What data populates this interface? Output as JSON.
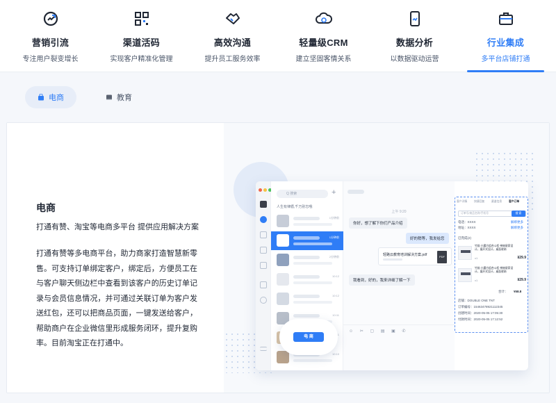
{
  "nav": {
    "items": [
      {
        "title": "营销引流",
        "sub": "专注用户裂变增长",
        "icon": "growth-icon"
      },
      {
        "title": "渠道活码",
        "sub": "实现客户精准化管理",
        "icon": "qrcode-icon"
      },
      {
        "title": "高效沟通",
        "sub": "提升员工服务效率",
        "icon": "handshake-icon"
      },
      {
        "title": "轻量级CRM",
        "sub": "建立坚固客情关系",
        "icon": "crm-cloud-icon"
      },
      {
        "title": "数据分析",
        "sub": "以数据驱动运营",
        "icon": "phone-chart-icon"
      },
      {
        "title": "行业集成",
        "sub": "多平台店铺打通",
        "icon": "briefcase-icon"
      }
    ],
    "active_index": 5,
    "accent": "#2f7df6"
  },
  "subtabs": {
    "ecommerce": "电商",
    "education": "教育"
  },
  "content": {
    "title": "电商",
    "tagline": "打通有赞、淘宝等电商多平台 提供应用解决方案",
    "description": "打通有赞等多电商平台，助力商家打造智慧新零售。可支持订单绑定客户，绑定后，方便员工在与客户聊天侧边栏中查看到该客户的历史订单记录与会员信息情况，并可通过关联订单为客户发送红包，还可以把商品页面，一键发送给客户，帮助商户在企业微信里形成服务闭环，提升复购率。目前淘宝正在打通中。"
  },
  "mock": {
    "search_placeholder": "Q 搜索",
    "notice": "人生有律循,千万别忘哦",
    "times": [
      "1分钟前",
      "1分钟前",
      "2分钟前",
      "10:12",
      "10:12",
      "10:11",
      "10:11",
      "10:10"
    ],
    "chat_time": "上午 9:20",
    "messages": {
      "m1": "你好，想了解下你们产品介绍",
      "m2": "好的稍等，我发给您",
      "file_name": "轻路云教育培训解决方案.pdf",
      "pdf": "PDF",
      "m3": "我看到，好的，我来详细了解一下"
    },
    "detail": {
      "tabs": [
        "客户详情",
        "快捷回复",
        "渠道信息",
        "客户订单"
      ],
      "input_placeholder": "订单号/商品名称/手机号",
      "send": "搜 索",
      "phone": "电话：XXXX",
      "phone_link": "解绑更多",
      "addr": "地址：XXXX",
      "addr_link": "解绑更多",
      "order_label": "已完成(2)",
      "p1_title": "竹韵 小魔方组合斗柜 带抽屉家设计，展开式设计，桌面收纳",
      "p1_price": "¥29.9",
      "p2_title": "竹韵 小魔方组合斗柜 带抽屉家设计，展开式设计，桌面收纳",
      "p2_price": "¥29.9",
      "qty": "x1",
      "total_label": "合计：",
      "total": "¥58.8",
      "f1": "店铺：DOUBLE ONE TNT",
      "f2": "订单编号：15463478921112345",
      "f3": "创建时间：2020-05-05 17:05:30",
      "f4": "付款时间：2020-05-05 17:12:52"
    },
    "pill_button": "电 商"
  }
}
